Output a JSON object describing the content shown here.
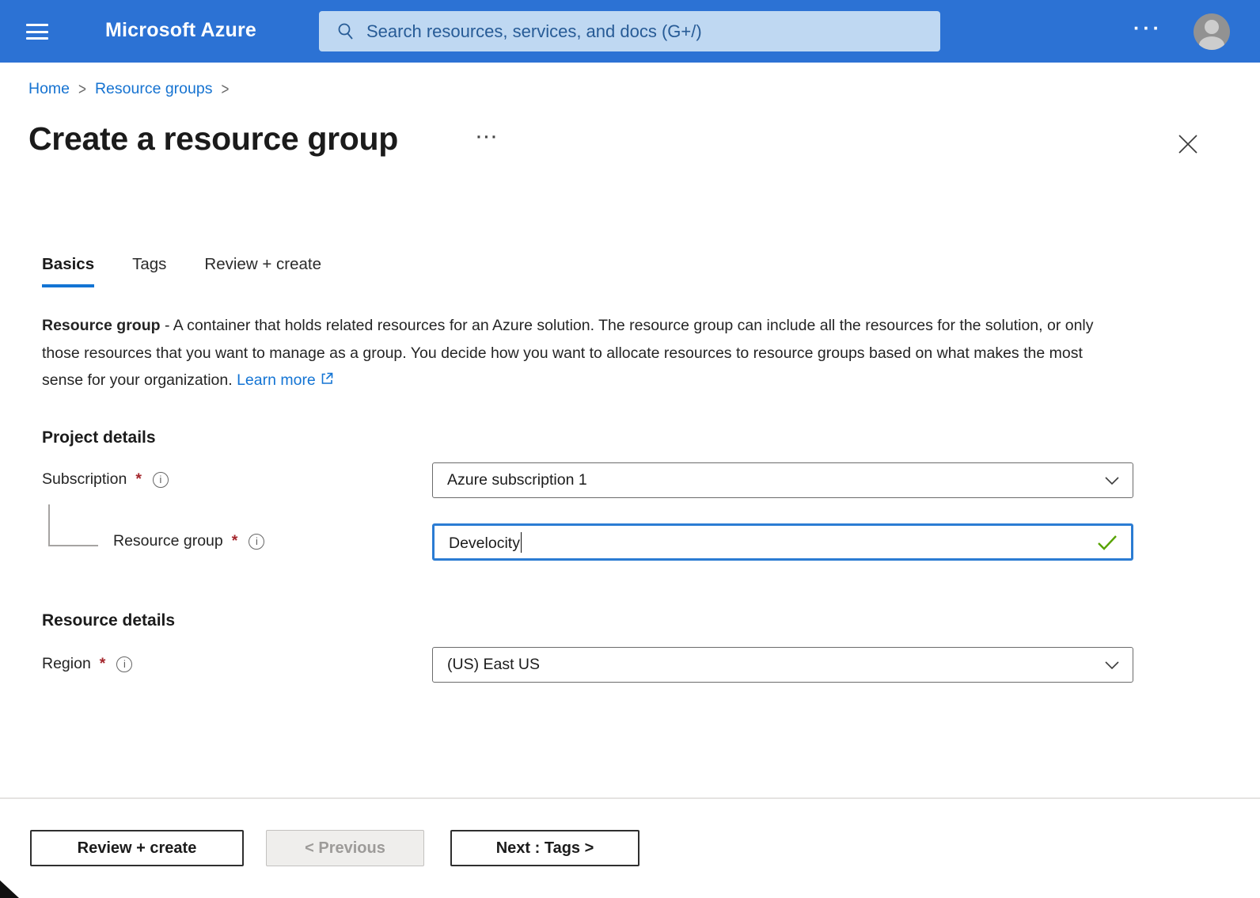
{
  "topbar": {
    "brand": "Microsoft Azure",
    "search_placeholder": "Search resources, services, and docs (G+/)",
    "overflow": "···"
  },
  "breadcrumb": {
    "separator": ">",
    "items": [
      {
        "label": "Home"
      },
      {
        "label": "Resource groups"
      }
    ]
  },
  "page": {
    "title": "Create a resource group",
    "ellipsis": "···"
  },
  "tabs": [
    {
      "label": "Basics",
      "active": true
    },
    {
      "label": "Tags",
      "active": false
    },
    {
      "label": "Review + create",
      "active": false
    }
  ],
  "description": {
    "lead": "Resource group",
    "body": " - A container that holds related resources for an Azure solution. The resource group can include all the resources for the solution, or only those resources that you want to manage as a group. You decide how you want to allocate resources to resource groups based on what makes the most sense for your organization. ",
    "link_label": "Learn more"
  },
  "sections": {
    "project_details": {
      "heading": "Project details",
      "subscription": {
        "label": "Subscription",
        "required": "*",
        "value": "Azure subscription 1"
      },
      "resource_group": {
        "label": "Resource group",
        "required": "*",
        "value": "Develocity",
        "valid": true
      }
    },
    "resource_details": {
      "heading": "Resource details",
      "region": {
        "label": "Region",
        "required": "*",
        "value": "(US) East US"
      }
    }
  },
  "footer": {
    "review_create_label": "Review + create",
    "previous_label": "< Previous",
    "next_label": "Next : Tags >"
  },
  "colors": {
    "topbar_blue": "#2c72d4",
    "search_bg": "#bfd8f2",
    "search_text": "#275b96",
    "link_blue": "#1374d4",
    "focus_border_blue": "#2b7cd3",
    "valid_green": "#57a300",
    "required_red": "#a4262c",
    "disabled_bg": "#efeeec",
    "disabled_text": "#9d9b99",
    "divider": "#e5e3e1"
  }
}
